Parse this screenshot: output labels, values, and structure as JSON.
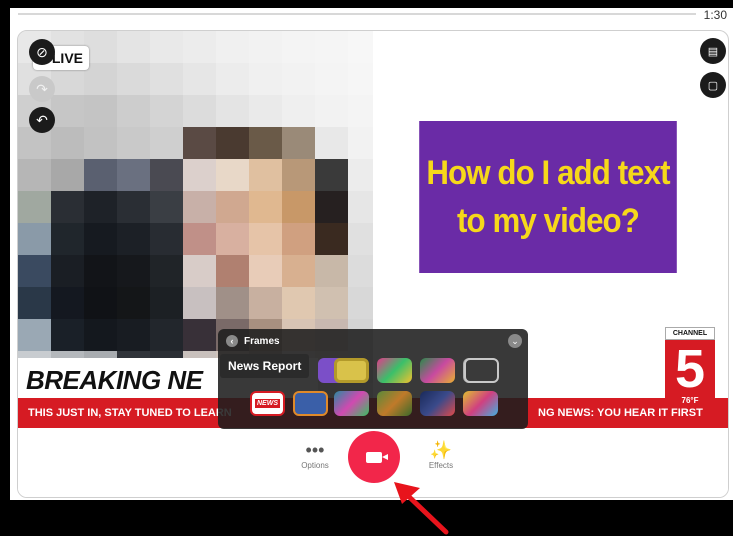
{
  "timer": "1:30",
  "video": {
    "live_label": "LIVE"
  },
  "callout": {
    "line1": "How do I add text",
    "line2": "to my video?"
  },
  "news": {
    "headline": "BREAKING NE",
    "ticker_left": "THIS JUST IN, STAY TUNED TO LEARN",
    "ticker_right": "NG NEWS: YOU HEAR IT FIRST"
  },
  "channel_logo": {
    "top": "CHANNEL",
    "number": "5",
    "temp": "76°F"
  },
  "frames_panel": {
    "title": "Frames",
    "tooltip": "News Report",
    "thumb_news_label": "NEWS"
  },
  "toolbar": {
    "options_label": "Options",
    "effects_label": "Effects"
  },
  "colors": {
    "record": "#f2264a",
    "ticker": "#d61b23",
    "callout_bg": "#6a2ba6",
    "callout_text": "#f6d81a"
  },
  "icons": [
    "ban-icon",
    "redo-icon",
    "undo-icon",
    "book-icon",
    "chat-icon",
    "back-icon",
    "chevron-down-icon",
    "dots-icon",
    "camera-icon",
    "magic-wand-icon",
    "arrow-annotation"
  ]
}
